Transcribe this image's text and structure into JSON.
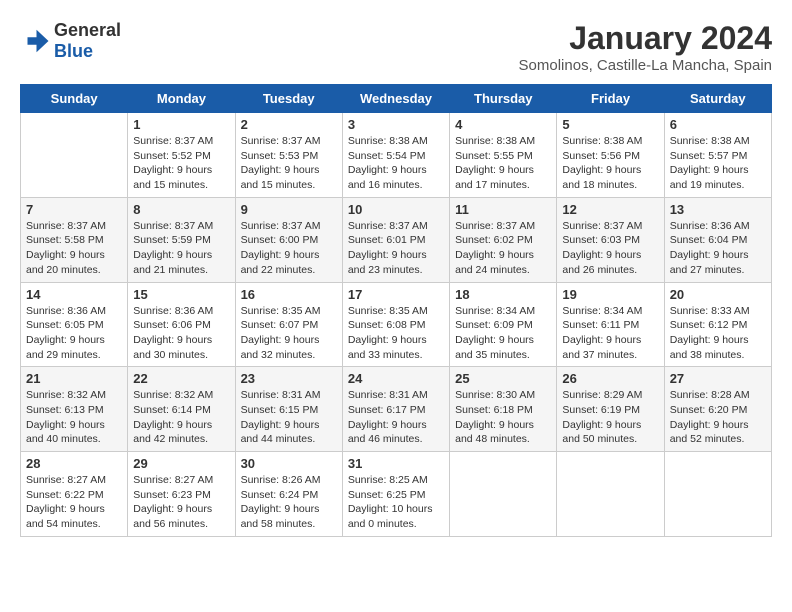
{
  "header": {
    "logo_general": "General",
    "logo_blue": "Blue",
    "title": "January 2024",
    "location": "Somolinos, Castille-La Mancha, Spain"
  },
  "weekdays": [
    "Sunday",
    "Monday",
    "Tuesday",
    "Wednesday",
    "Thursday",
    "Friday",
    "Saturday"
  ],
  "weeks": [
    [
      {
        "day": "",
        "content": ""
      },
      {
        "day": "1",
        "content": "Sunrise: 8:37 AM\nSunset: 5:52 PM\nDaylight: 9 hours\nand 15 minutes."
      },
      {
        "day": "2",
        "content": "Sunrise: 8:37 AM\nSunset: 5:53 PM\nDaylight: 9 hours\nand 15 minutes."
      },
      {
        "day": "3",
        "content": "Sunrise: 8:38 AM\nSunset: 5:54 PM\nDaylight: 9 hours\nand 16 minutes."
      },
      {
        "day": "4",
        "content": "Sunrise: 8:38 AM\nSunset: 5:55 PM\nDaylight: 9 hours\nand 17 minutes."
      },
      {
        "day": "5",
        "content": "Sunrise: 8:38 AM\nSunset: 5:56 PM\nDaylight: 9 hours\nand 18 minutes."
      },
      {
        "day": "6",
        "content": "Sunrise: 8:38 AM\nSunset: 5:57 PM\nDaylight: 9 hours\nand 19 minutes."
      }
    ],
    [
      {
        "day": "7",
        "content": "Sunrise: 8:37 AM\nSunset: 5:58 PM\nDaylight: 9 hours\nand 20 minutes."
      },
      {
        "day": "8",
        "content": "Sunrise: 8:37 AM\nSunset: 5:59 PM\nDaylight: 9 hours\nand 21 minutes."
      },
      {
        "day": "9",
        "content": "Sunrise: 8:37 AM\nSunset: 6:00 PM\nDaylight: 9 hours\nand 22 minutes."
      },
      {
        "day": "10",
        "content": "Sunrise: 8:37 AM\nSunset: 6:01 PM\nDaylight: 9 hours\nand 23 minutes."
      },
      {
        "day": "11",
        "content": "Sunrise: 8:37 AM\nSunset: 6:02 PM\nDaylight: 9 hours\nand 24 minutes."
      },
      {
        "day": "12",
        "content": "Sunrise: 8:37 AM\nSunset: 6:03 PM\nDaylight: 9 hours\nand 26 minutes."
      },
      {
        "day": "13",
        "content": "Sunrise: 8:36 AM\nSunset: 6:04 PM\nDaylight: 9 hours\nand 27 minutes."
      }
    ],
    [
      {
        "day": "14",
        "content": "Sunrise: 8:36 AM\nSunset: 6:05 PM\nDaylight: 9 hours\nand 29 minutes."
      },
      {
        "day": "15",
        "content": "Sunrise: 8:36 AM\nSunset: 6:06 PM\nDaylight: 9 hours\nand 30 minutes."
      },
      {
        "day": "16",
        "content": "Sunrise: 8:35 AM\nSunset: 6:07 PM\nDaylight: 9 hours\nand 32 minutes."
      },
      {
        "day": "17",
        "content": "Sunrise: 8:35 AM\nSunset: 6:08 PM\nDaylight: 9 hours\nand 33 minutes."
      },
      {
        "day": "18",
        "content": "Sunrise: 8:34 AM\nSunset: 6:09 PM\nDaylight: 9 hours\nand 35 minutes."
      },
      {
        "day": "19",
        "content": "Sunrise: 8:34 AM\nSunset: 6:11 PM\nDaylight: 9 hours\nand 37 minutes."
      },
      {
        "day": "20",
        "content": "Sunrise: 8:33 AM\nSunset: 6:12 PM\nDaylight: 9 hours\nand 38 minutes."
      }
    ],
    [
      {
        "day": "21",
        "content": "Sunrise: 8:32 AM\nSunset: 6:13 PM\nDaylight: 9 hours\nand 40 minutes."
      },
      {
        "day": "22",
        "content": "Sunrise: 8:32 AM\nSunset: 6:14 PM\nDaylight: 9 hours\nand 42 minutes."
      },
      {
        "day": "23",
        "content": "Sunrise: 8:31 AM\nSunset: 6:15 PM\nDaylight: 9 hours\nand 44 minutes."
      },
      {
        "day": "24",
        "content": "Sunrise: 8:31 AM\nSunset: 6:17 PM\nDaylight: 9 hours\nand 46 minutes."
      },
      {
        "day": "25",
        "content": "Sunrise: 8:30 AM\nSunset: 6:18 PM\nDaylight: 9 hours\nand 48 minutes."
      },
      {
        "day": "26",
        "content": "Sunrise: 8:29 AM\nSunset: 6:19 PM\nDaylight: 9 hours\nand 50 minutes."
      },
      {
        "day": "27",
        "content": "Sunrise: 8:28 AM\nSunset: 6:20 PM\nDaylight: 9 hours\nand 52 minutes."
      }
    ],
    [
      {
        "day": "28",
        "content": "Sunrise: 8:27 AM\nSunset: 6:22 PM\nDaylight: 9 hours\nand 54 minutes."
      },
      {
        "day": "29",
        "content": "Sunrise: 8:27 AM\nSunset: 6:23 PM\nDaylight: 9 hours\nand 56 minutes."
      },
      {
        "day": "30",
        "content": "Sunrise: 8:26 AM\nSunset: 6:24 PM\nDaylight: 9 hours\nand 58 minutes."
      },
      {
        "day": "31",
        "content": "Sunrise: 8:25 AM\nSunset: 6:25 PM\nDaylight: 10 hours\nand 0 minutes."
      },
      {
        "day": "",
        "content": ""
      },
      {
        "day": "",
        "content": ""
      },
      {
        "day": "",
        "content": ""
      }
    ]
  ]
}
